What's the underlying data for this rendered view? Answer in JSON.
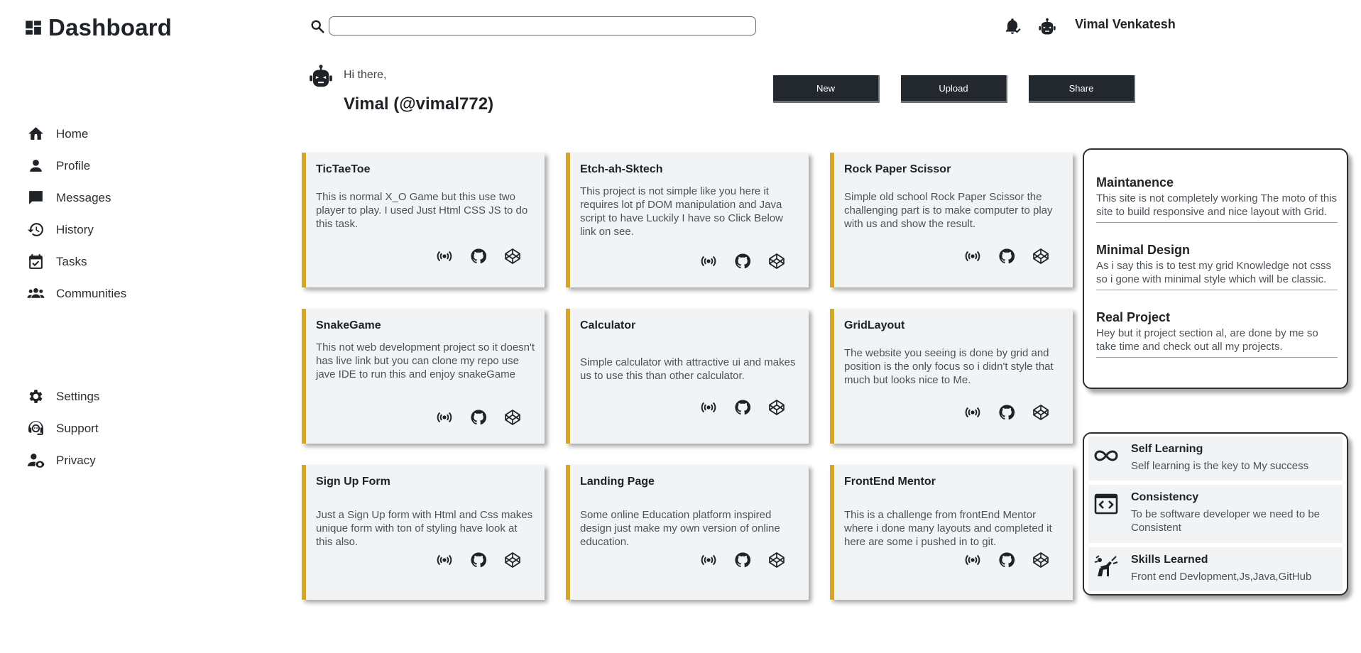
{
  "brand": {
    "title": "Dashboard",
    "icon": "dashboard-icon"
  },
  "nav_top": [
    {
      "label": "Home",
      "icon": "home-icon"
    },
    {
      "label": "Profile",
      "icon": "person-icon"
    },
    {
      "label": "Messages",
      "icon": "chat-icon"
    },
    {
      "label": "History",
      "icon": "history-icon"
    },
    {
      "label": "Tasks",
      "icon": "calendar-check-icon"
    },
    {
      "label": "Communities",
      "icon": "groups-icon"
    }
  ],
  "nav_bottom": [
    {
      "label": "Settings",
      "icon": "gear-icon"
    },
    {
      "label": "Support",
      "icon": "support-icon"
    },
    {
      "label": "Privacy",
      "icon": "privacy-icon"
    }
  ],
  "header": {
    "search_value": "",
    "user_name": "Vimal Venkatesh"
  },
  "greeting": {
    "hi": "Hi there,",
    "handle": "Vimal (@vimal772)"
  },
  "actions": {
    "new": "New",
    "upload": "Upload",
    "share": "Share"
  },
  "projects": [
    {
      "title": "TicTaeToe",
      "desc": "This is normal X_O Game but this use two player to play. I used Just Html CSS JS to do this task."
    },
    {
      "title": "Etch-ah-Sktech",
      "desc": "This project is not simple like you here it requires lot pf DOM manipulation and Java script to have Luckily I have so Click Below link on see."
    },
    {
      "title": "Rock Paper Scissor",
      "desc": "Simple old school Rock Paper Scissor the challenging part is to make computer to play with us and show the result."
    },
    {
      "title": "SnakeGame",
      "desc": "This not web development project so it doesn't has live link but you can clone my repo use jave IDE to run this and enjoy snakeGame"
    },
    {
      "title": "Calculator",
      "desc": "Simple calculator with attractive ui and makes us to use this than other calculator."
    },
    {
      "title": "GridLayout",
      "desc": "The website you seeing is done by grid and position is the only focus so i didn't style that much but looks nice to Me."
    },
    {
      "title": "Sign Up Form",
      "desc": "Just a Sign Up form with Html and Css makes unique form with ton of styling have look at this also."
    },
    {
      "title": "Landing Page",
      "desc": "Some online Education platform inspired design just make my own version of online education."
    },
    {
      "title": "FrontEnd Mentor",
      "desc": "This is a challenge from frontEnd Mentor where i done many layouts and completed it here are some i pushed in to git."
    }
  ],
  "announcements": [
    {
      "title": "Maintanence",
      "text": "This site is not completely working The moto of this site to build responsive and nice layout with Grid."
    },
    {
      "title": "Minimal Design",
      "text": "As i say this is to test my grid Knowledge not csss so i gone with minimal style which will be classic."
    },
    {
      "title": "Real Project",
      "text": "Hey but it project section al, are done by me so take time and check out all my projects."
    }
  ],
  "trending": [
    {
      "title": "Self Learning",
      "text": "Self learning is the key to My success",
      "icon": "infinity-icon"
    },
    {
      "title": "Consistency",
      "text": "To be software developer we need to be Consistent",
      "icon": "code-brackets-icon"
    },
    {
      "title": "Skills Learned",
      "text": "Front end Devlopment,Js,Java,GitHub",
      "icon": "agility-icon"
    }
  ],
  "colors": {
    "accent": "#d4a72c",
    "button_bg": "#22282e",
    "card_bg": "#f1f3f5"
  }
}
